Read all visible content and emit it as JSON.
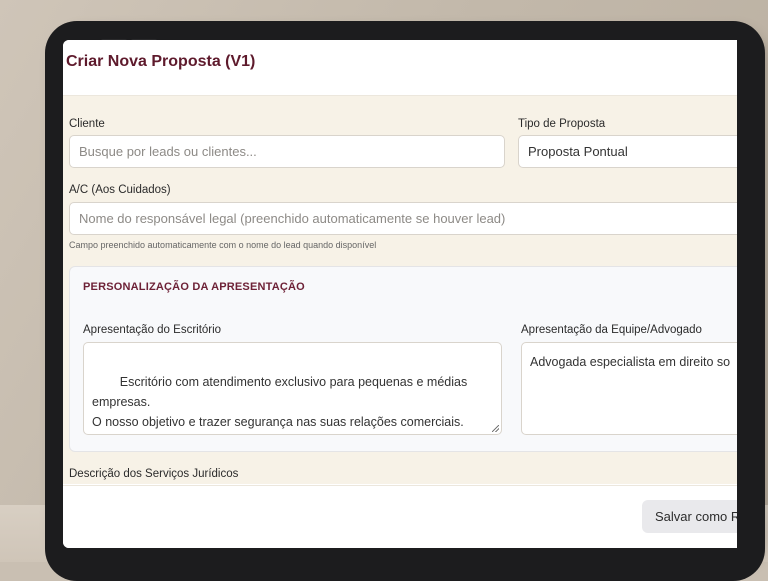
{
  "header": {
    "title": "Criar Nova Proposta (V1)"
  },
  "form": {
    "cliente": {
      "label": "Cliente",
      "placeholder": "Busque por leads ou clientes..."
    },
    "tipo_proposta": {
      "label": "Tipo de Proposta",
      "value": "Proposta Pontual"
    },
    "ac": {
      "label": "A/C (Aos Cuidados)",
      "placeholder": "Nome do responsável legal (preenchido automaticamente se houver lead)",
      "hint": "Campo preenchido automaticamente com o nome do lead quando disponível"
    },
    "personalizacao": {
      "title": "PERSONALIZAÇÃO DA APRESENTAÇÃO",
      "escritorio": {
        "label": "Apresentação do Escritório",
        "value": "Escritório com atendimento exclusivo para pequenas e médias empresas.\nO nosso objetivo e trazer segurança nas suas relações comerciais."
      },
      "equipe": {
        "label": "Apresentação da Equipe/Advogado",
        "value": "Advogada especialista em direito so"
      }
    },
    "descricao": {
      "label": "Descrição dos Serviços Jurídicos"
    }
  },
  "footer": {
    "save_label": "Salvar como R"
  }
}
